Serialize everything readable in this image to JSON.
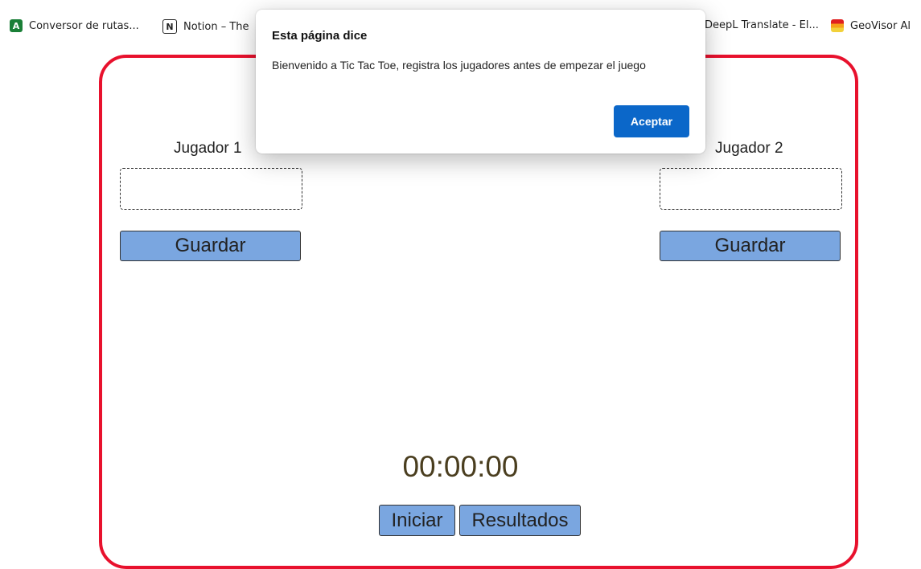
{
  "bookmarks": [
    {
      "label": "Conversor de rutas...",
      "icon": "app-a-icon"
    },
    {
      "label": "Notion – The",
      "icon": "notion-icon"
    },
    {
      "label": "DeepL Translate - El...",
      "icon": "deepl-icon"
    },
    {
      "label": "GeoVisor Al",
      "icon": "geovisor-icon"
    }
  ],
  "game": {
    "player1": {
      "label": "Jugador 1",
      "save_label": "Guardar"
    },
    "player2": {
      "label": "Jugador 2",
      "save_label": "Guardar"
    },
    "timer": "00:00:00",
    "start_label": "Iniciar",
    "results_label": "Resultados",
    "accent_color": "#e8112d",
    "button_color": "#7aa6e0"
  },
  "dialog": {
    "title": "Esta página dice",
    "message": "Bienvenido a Tic Tac Toe, registra los jugadores antes de empezar el juego",
    "ok_label": "Aceptar",
    "ok_color": "#0b67c9"
  }
}
